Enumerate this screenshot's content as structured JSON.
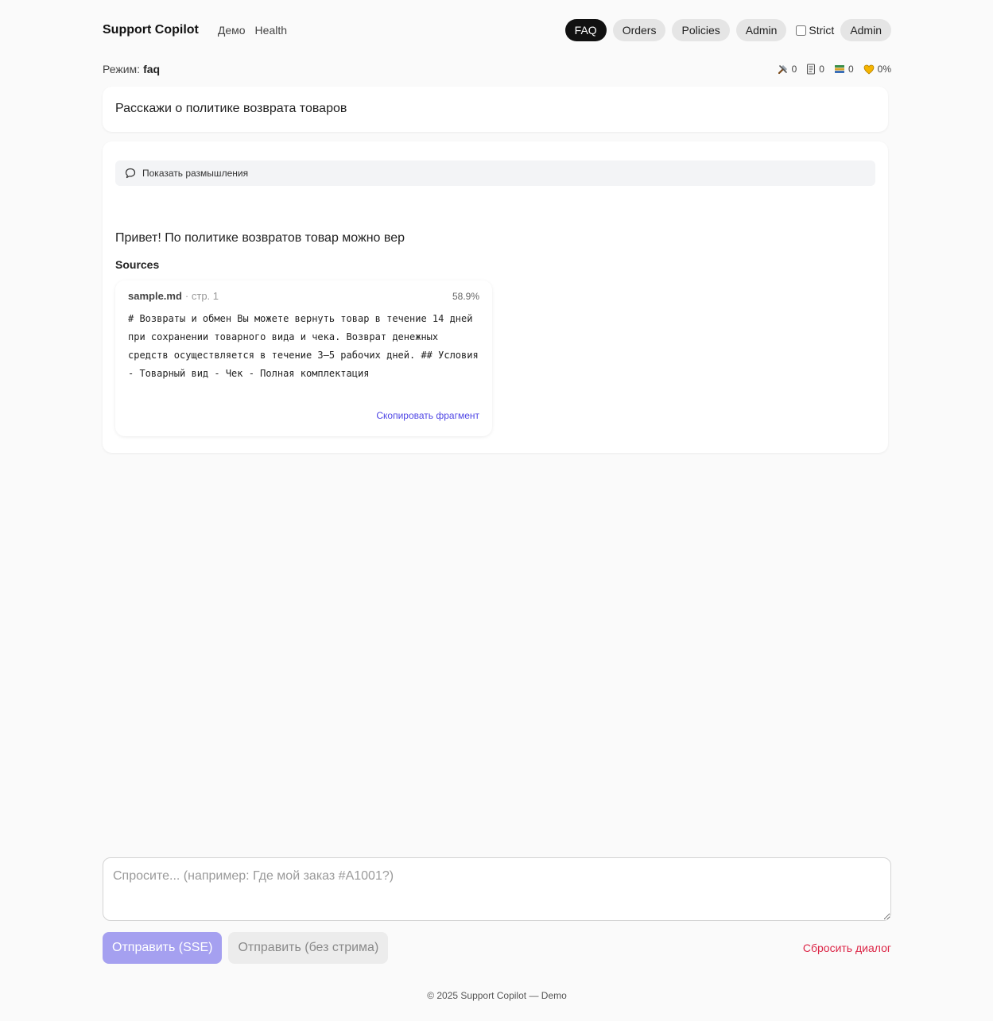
{
  "header": {
    "brand": "Support Copilot",
    "nav": [
      "Демо",
      "Health"
    ],
    "mode_buttons": [
      "FAQ",
      "Orders",
      "Policies",
      "Admin"
    ],
    "active_mode": "FAQ",
    "strict_label": "Strict",
    "strict_checked": false,
    "admin_label": "Admin"
  },
  "mode_row": {
    "label": "Режим:",
    "value": "faq",
    "stats": [
      {
        "icon": "tools-icon",
        "value": "0"
      },
      {
        "icon": "document-icon",
        "value": "0"
      },
      {
        "icon": "books-icon",
        "value": "0"
      },
      {
        "icon": "heart-icon",
        "value": "0%"
      }
    ]
  },
  "question": "Расскажи о политике возврата товаров",
  "answer_card": {
    "thinking_label": "Показать размышления",
    "answer_text": "Привет! По политике возвратов товар можно вер",
    "sources_title": "Sources",
    "sources": [
      {
        "file": "sample.md",
        "page": "· стр. 1",
        "score": "58.9%",
        "text": "# Возвраты и обмен Вы можете вернуть товар в течение 14 дней при сохранении товарного вида и чека. Возврат денежных средств осуществляется в течение 3–5 рабочих дней. ## Условия - Товарный вид - Чек - Полная комплектация",
        "copy_label": "Скопировать фрагмент"
      }
    ]
  },
  "composer": {
    "placeholder": "Спросите... (например: Где мой заказ #A1001?)",
    "value": ""
  },
  "actions": {
    "send_sse": "Отправить (SSE)",
    "send_nostream": "Отправить (без стрима)",
    "reset": "Сбросить диалог"
  },
  "footer": "© 2025 Support Copilot — Demo"
}
